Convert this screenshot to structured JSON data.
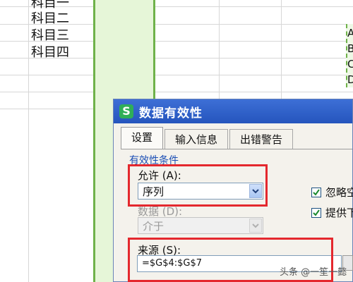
{
  "sheet": {
    "column_a": [
      "科目一",
      "科目二",
      "科目三",
      "科目四"
    ],
    "column_g": [
      "A",
      "B",
      "C",
      "D"
    ]
  },
  "dialog": {
    "title": "数据有效性",
    "app_icon": "S",
    "tabs": [
      "设置",
      "输入信息",
      "出错警告"
    ],
    "active_tab": "设置",
    "section_label": "有效性条件",
    "allow_label": "允许 (A):",
    "allow_value": "序列",
    "data_label": "数据 (D):",
    "data_value": "介于",
    "ignore_blank_label": "忽略空",
    "ignore_blank_checked": true,
    "in_cell_dropdown_label": "提供下",
    "in_cell_dropdown_checked": true,
    "source_label": "来源 (S):",
    "source_value": "=$G$4:$G$7"
  },
  "watermark": "头条 @一笙一懿",
  "colors": {
    "highlight_border": "#e4282e",
    "selection_green": "#6fb24a",
    "titlebar_blue": "#2555bd"
  }
}
